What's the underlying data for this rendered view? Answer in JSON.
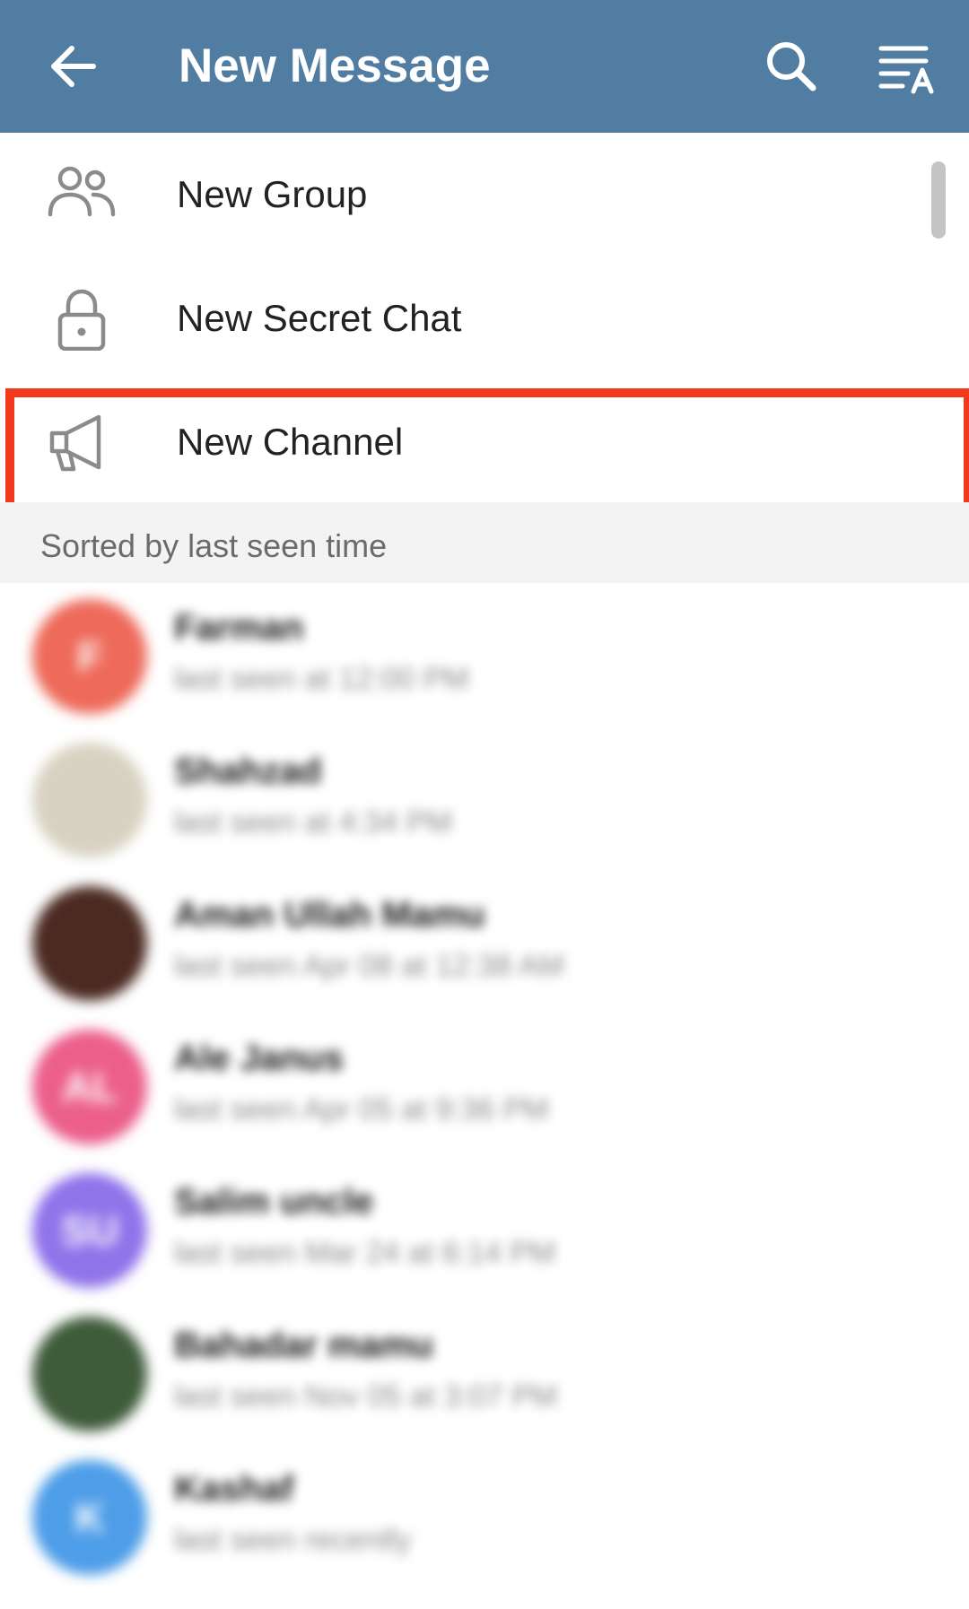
{
  "header": {
    "title": "New Message",
    "background": "#527da3"
  },
  "menu": [
    {
      "label": "New Group",
      "icon": "group-icon"
    },
    {
      "label": "New Secret Chat",
      "icon": "lock-icon"
    },
    {
      "label": "New Channel",
      "icon": "megaphone-icon",
      "highlighted": true
    }
  ],
  "highlight_color": "#f2391b",
  "section_header": "Sorted by last seen time",
  "contacts": [
    {
      "initial": "F",
      "name": "Farman",
      "status": "last seen at 12:00 PM",
      "avatar_color": "#ee6a5a"
    },
    {
      "initial": "",
      "name": "Shahzad",
      "status": "last seen at 4:34 PM",
      "avatar_color": "#d8d2c2"
    },
    {
      "initial": "",
      "name": "Aman Ullah Mamu",
      "status": "last seen Apr 08 at 12:38 AM",
      "avatar_color": "#4b2a22"
    },
    {
      "initial": "AL",
      "name": "Ale Janus",
      "status": "last seen Apr 05 at 9:36 PM",
      "avatar_color": "#ec5f8c"
    },
    {
      "initial": "SU",
      "name": "Salim uncle",
      "status": "last seen Mar 24 at 6:14 PM",
      "avatar_color": "#8f73ea"
    },
    {
      "initial": "",
      "name": "Bahadar mamu",
      "status": "last seen Nov 05 at 3:07 PM",
      "avatar_color": "#3e5b3a"
    },
    {
      "initial": "K",
      "name": "Kashaf",
      "status": "last seen recently",
      "avatar_color": "#4d9de8"
    }
  ]
}
